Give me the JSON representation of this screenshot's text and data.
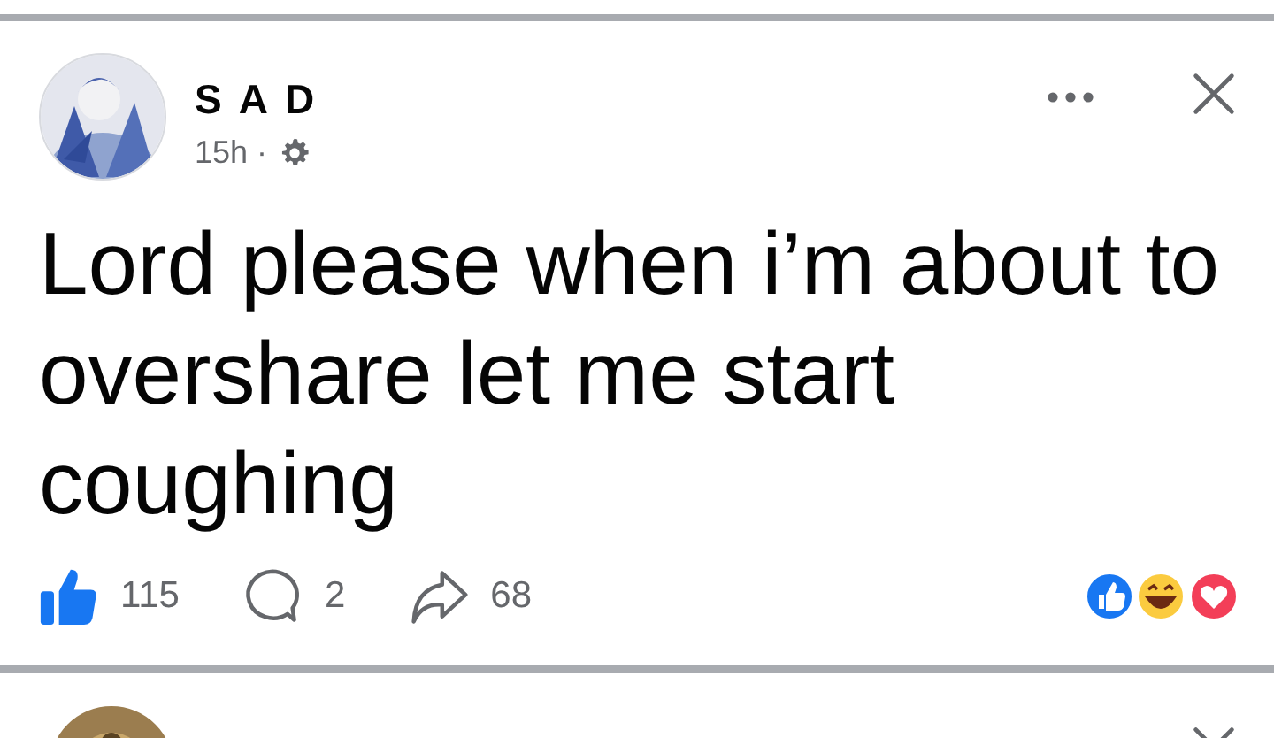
{
  "post": {
    "author": "S A D",
    "time": "15h ·",
    "text": "Lord please when i’m about to overshare let me start coughing",
    "actions": [
      {
        "kind": "like",
        "count": "115"
      },
      {
        "kind": "comment",
        "count": "2"
      },
      {
        "kind": "share",
        "count": "68"
      }
    ]
  }
}
